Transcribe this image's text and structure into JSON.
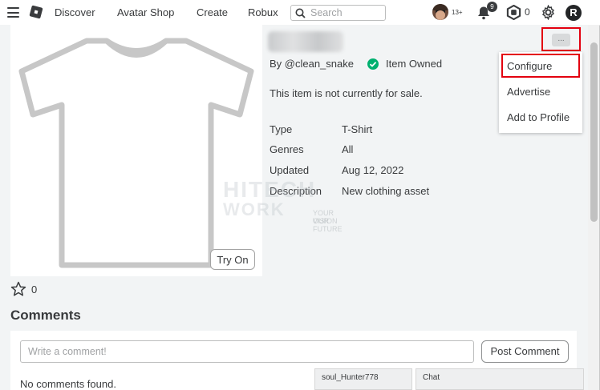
{
  "nav": {
    "discover": "Discover",
    "avatar_shop": "Avatar Shop",
    "create": "Create",
    "robux": "Robux",
    "search_placeholder": "Search",
    "age_label": "13+",
    "notification_count": "9",
    "robux_balance": "0"
  },
  "item": {
    "creator": "By @clean_snake",
    "owned_label": "Item Owned",
    "sale_status": "This item is not currently for sale.",
    "try_on": "Try On",
    "favorites": "0",
    "details": [
      {
        "label": "Type",
        "value": "T-Shirt"
      },
      {
        "label": "Genres",
        "value": "All"
      },
      {
        "label": "Updated",
        "value": "Aug 12, 2022"
      },
      {
        "label": "Description",
        "value": "New clothing asset"
      }
    ]
  },
  "menu": {
    "more_icon_label": "...",
    "items": [
      "Configure",
      "Advertise",
      "Add to Profile"
    ]
  },
  "comments": {
    "heading": "Comments",
    "placeholder": "Write a comment!",
    "post_button": "Post Comment",
    "empty_text": "No comments found."
  },
  "chat": {
    "user_tab": "soul_Hunter778",
    "chat_tab": "Chat"
  },
  "watermark": {
    "line1": "HITECH",
    "line2": "WORK",
    "tag1": "YOUR VISION",
    "tag2": "OUR FUTURE"
  },
  "colors": {
    "accent_red": "#e3000f",
    "owned_green": "#00b06f",
    "text": "#393b3d",
    "content_bg": "#f2f4f5"
  }
}
